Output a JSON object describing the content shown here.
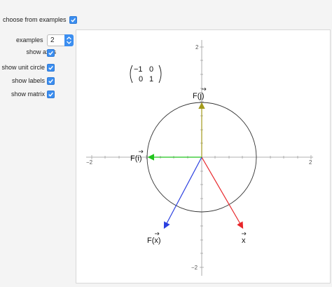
{
  "controls": {
    "choose_from_examples": {
      "label": "choose from examples",
      "checked": true
    },
    "examples": {
      "label": "examples",
      "value": "2"
    },
    "show_axes": {
      "label": "show axes",
      "checked": true
    },
    "show_unit_circle": {
      "label": "show unit circle",
      "checked": true
    },
    "show_labels": {
      "label": "show labels",
      "checked": true
    },
    "show_matrix": {
      "label": "show matrix",
      "checked": true
    }
  },
  "plot": {
    "matrix": [
      [
        "−1",
        "0"
      ],
      [
        "0",
        "1"
      ]
    ],
    "x_ticks": [
      "−2",
      "2"
    ],
    "y_ticks": [
      "2",
      "−2"
    ],
    "labels": {
      "x_vec": "x",
      "f_x_vec": "F(",
      "f_x_vec_arg": "x",
      "f_i_vec": "F(",
      "f_i_vec_arg": "i",
      "f_j_vec": "F(",
      "f_j_vec_arg": "j",
      "close_paren": ")"
    },
    "colors": {
      "x_vec": "#e8262a",
      "f_x_vec": "#2a3fe0",
      "f_i_vec": "#22c41e",
      "f_j_vec": "#a39a1a",
      "circle": "#333333",
      "axes": "#999999",
      "accent": "#3b8ef0"
    }
  }
}
